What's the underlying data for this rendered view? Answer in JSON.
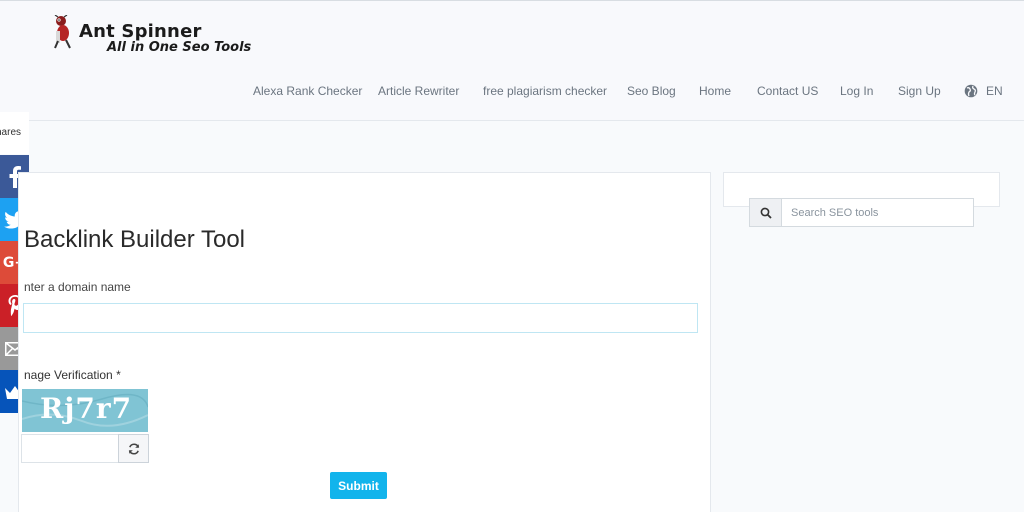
{
  "brand": {
    "title": "Ant Spinner",
    "tagline": "All in One Seo Tools"
  },
  "nav": {
    "items": [
      {
        "label": "Alexa Rank Checker"
      },
      {
        "label": "Article Rewriter"
      },
      {
        "label": "free plagiarism checker"
      },
      {
        "label": "Seo Blog"
      },
      {
        "label": "Home"
      },
      {
        "label": "Contact US"
      },
      {
        "label": "Log In"
      },
      {
        "label": "Sign Up"
      }
    ],
    "language": "EN"
  },
  "share": {
    "count_label": "hares",
    "buttons": [
      {
        "name": "facebook",
        "color": "#3b5998",
        "icon": "facebook-icon"
      },
      {
        "name": "twitter",
        "color": "#1da1f2",
        "icon": "twitter-icon"
      },
      {
        "name": "google-plus",
        "color": "#dd4b39",
        "icon": "google-plus-icon"
      },
      {
        "name": "pinterest",
        "color": "#cb2027",
        "icon": "pinterest-icon"
      },
      {
        "name": "email",
        "color": "#999999",
        "icon": "email-icon"
      },
      {
        "name": "sumo",
        "color": "#0654ba",
        "icon": "crown-icon"
      }
    ]
  },
  "main": {
    "title": "Backlink Builder Tool",
    "domain_label": "nter a domain name",
    "domain_value": "",
    "captcha_label": "nage Verification *",
    "captcha_text": "Rj7r7",
    "captcha_value": "",
    "submit_label": "Submit"
  },
  "sidebar": {
    "search_placeholder": "Search SEO tools"
  },
  "colors": {
    "accent": "#12b4ec",
    "background": "#f8fafc"
  }
}
